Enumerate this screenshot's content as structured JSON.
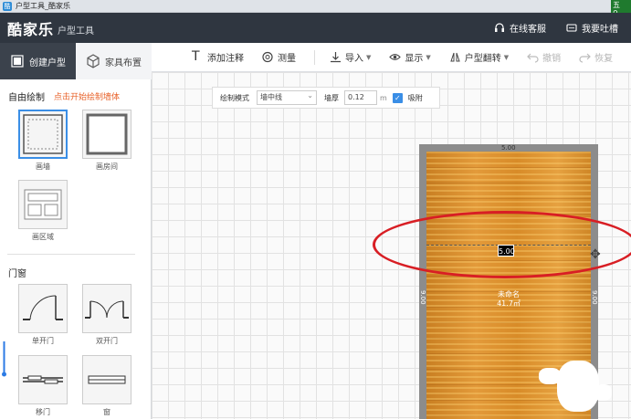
{
  "window": {
    "title": "户型工具_酷家乐",
    "icon_glyph": "酷"
  },
  "corner_widget": {
    "line1": "五",
    "line2": "⚲"
  },
  "header": {
    "logo": "酷家乐",
    "logo_sub": "户型工具",
    "support_label": "在线客服",
    "feedback_label": "我要吐槽"
  },
  "left_tabs": [
    {
      "label": "创建户型"
    },
    {
      "label": "家具布置"
    }
  ],
  "left_panel": {
    "free_draw_title": "自由绘制",
    "free_draw_hint": "点击开始绘制墙体",
    "tools": [
      {
        "label": "画墙"
      },
      {
        "label": "画房间"
      },
      {
        "label": "画区域"
      }
    ],
    "doors_title": "门窗",
    "door_tools": [
      {
        "label": "单开门"
      },
      {
        "label": "双开门"
      },
      {
        "label": "移门"
      },
      {
        "label": "窗"
      }
    ]
  },
  "toolbar": {
    "annotate": "添加注释",
    "measure": "测量",
    "import": "导入",
    "display": "显示",
    "flip": "户型翻转",
    "undo": "撤销",
    "redo": "恢复"
  },
  "draw_bar": {
    "mode_label": "绘制模式",
    "mode_value": "墙中线",
    "thickness_label": "墙厚",
    "thickness_value": "0.12",
    "unit": "m",
    "snap_label": "吸附"
  },
  "room": {
    "top_dim": "5.00",
    "side_dim_left": "9.00",
    "side_dim_right": "9.00",
    "name": "未命名",
    "area": "41.7㎡",
    "edit_value": "5.00"
  },
  "colors": {
    "header_bg": "#2f3640",
    "accent": "#3a8ee6",
    "hint": "#e8632b",
    "annotation_ellipse": "#d81e24",
    "wall": "#8c8c8c",
    "floor": "#d98d2b"
  }
}
